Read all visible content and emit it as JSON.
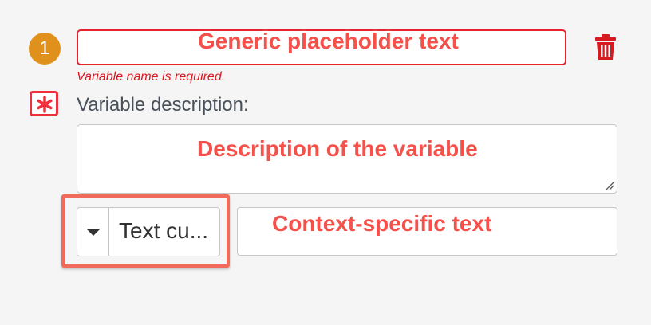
{
  "variable": {
    "index": "1",
    "name_value": "",
    "name_error": "Variable name is required.",
    "description_label": "Variable description:",
    "description_value": "",
    "type_selected": "Text cu...",
    "context_value": ""
  },
  "annotations": {
    "name": "Generic placeholder text",
    "description": "Description of the variable",
    "context": "Context-specific text"
  },
  "icons": {
    "delete": "trash-icon",
    "required": "asterisk-icon",
    "dropdown": "caret-down-icon",
    "resize": "resize-handle-icon"
  },
  "colors": {
    "badge": "#e0911c",
    "error": "#e5242f",
    "annotation": "#f26a5c"
  }
}
